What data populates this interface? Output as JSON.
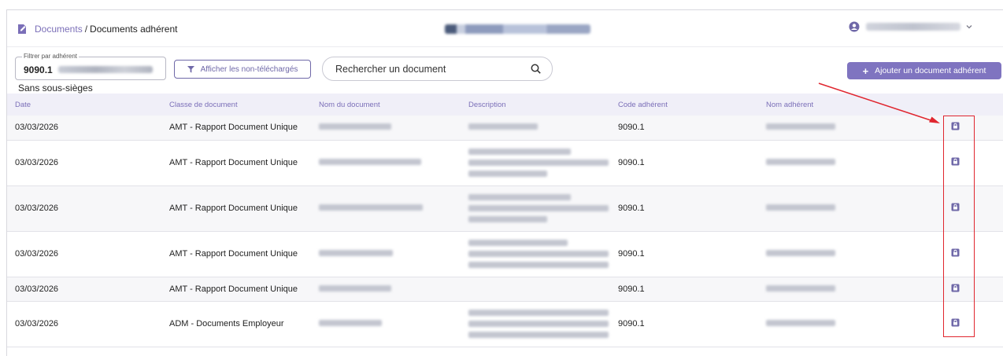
{
  "breadcrumb": {
    "root": "Documents",
    "separator": "/",
    "current": "Documents adhérent"
  },
  "filter": {
    "label": "Filtrer par adhérent",
    "value": "9090.1"
  },
  "buttons": {
    "show_not_downloaded": "Afficher les non-téléchargés",
    "add_document": "Ajouter un document adhérent"
  },
  "search": {
    "placeholder": "Rechercher un document"
  },
  "section": {
    "title": "Sans sous-sièges"
  },
  "table": {
    "headers": [
      "Date",
      "Classe de document",
      "Nom du document",
      "Description",
      "Code adhérent",
      "Nom adhérent"
    ],
    "rows": [
      {
        "date": "03/03/2026",
        "class": "AMT - Rapport Document Unique",
        "code": "9090.1"
      },
      {
        "date": "03/03/2026",
        "class": "AMT - Rapport Document Unique",
        "code": "9090.1"
      },
      {
        "date": "03/03/2026",
        "class": "AMT - Rapport Document Unique",
        "code": "9090.1"
      },
      {
        "date": "03/03/2026",
        "class": "AMT - Rapport Document Unique",
        "code": "9090.1"
      },
      {
        "date": "03/03/2026",
        "class": "AMT - Rapport Document Unique",
        "code": "9090.1"
      },
      {
        "date": "03/03/2026",
        "class": "ADM - Documents Employeur",
        "code": "9090.1"
      }
    ]
  },
  "icons": {
    "breadcrumb": "document-icon",
    "user": "user-circle-icon",
    "filter": "funnel-icon",
    "search": "search-icon",
    "row_action": "lock-icon"
  },
  "colors": {
    "accent": "#7f74c0",
    "link": "#7b6fb8",
    "annotation": "#e0262f"
  }
}
